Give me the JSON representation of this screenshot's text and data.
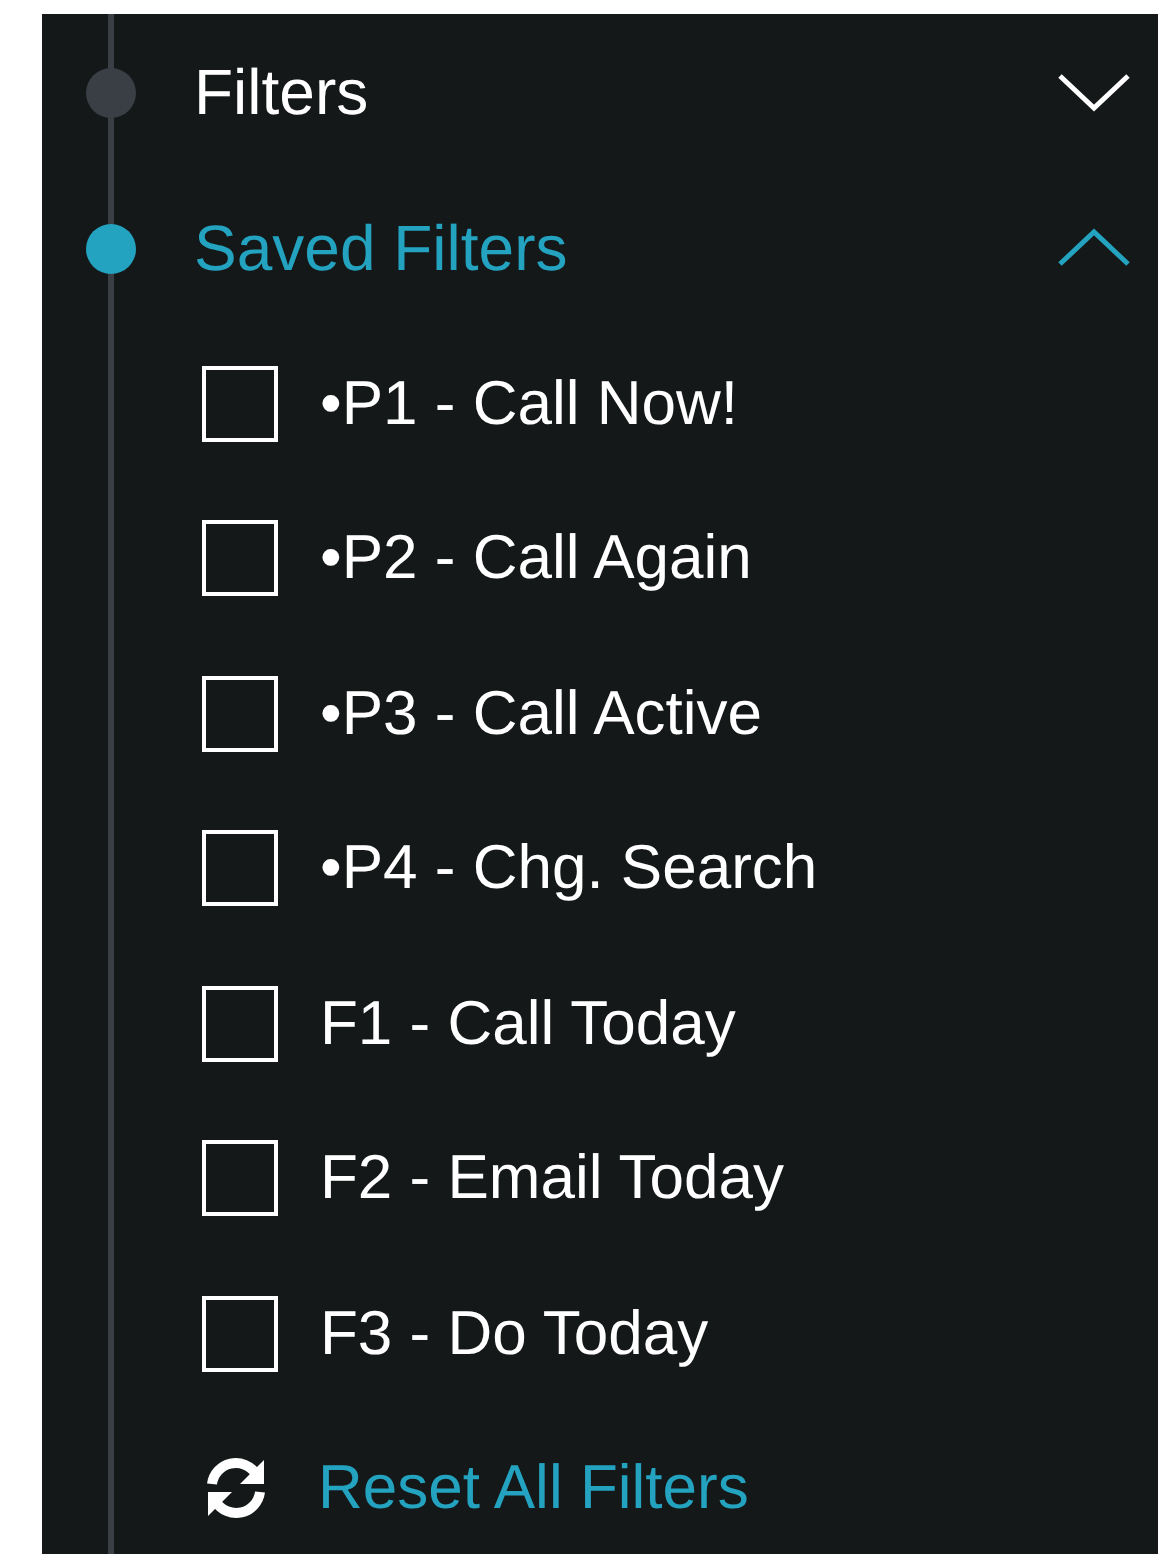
{
  "sections": [
    {
      "title": "Filters",
      "active": false,
      "expanded": false
    },
    {
      "title": "Saved Filters",
      "active": true,
      "expanded": true,
      "items": [
        {
          "label": "•P1 - Call Now!",
          "checked": false
        },
        {
          "label": "•P2 - Call Again",
          "checked": false
        },
        {
          "label": "•P3 - Call Active",
          "checked": false
        },
        {
          "label": "•P4 - Chg. Search",
          "checked": false
        },
        {
          "label": "F1 - Call Today",
          "checked": false
        },
        {
          "label": "F2 - Email Today",
          "checked": false
        },
        {
          "label": "F3 - Do Today",
          "checked": false
        }
      ],
      "action": "Reset All Filters"
    }
  ]
}
